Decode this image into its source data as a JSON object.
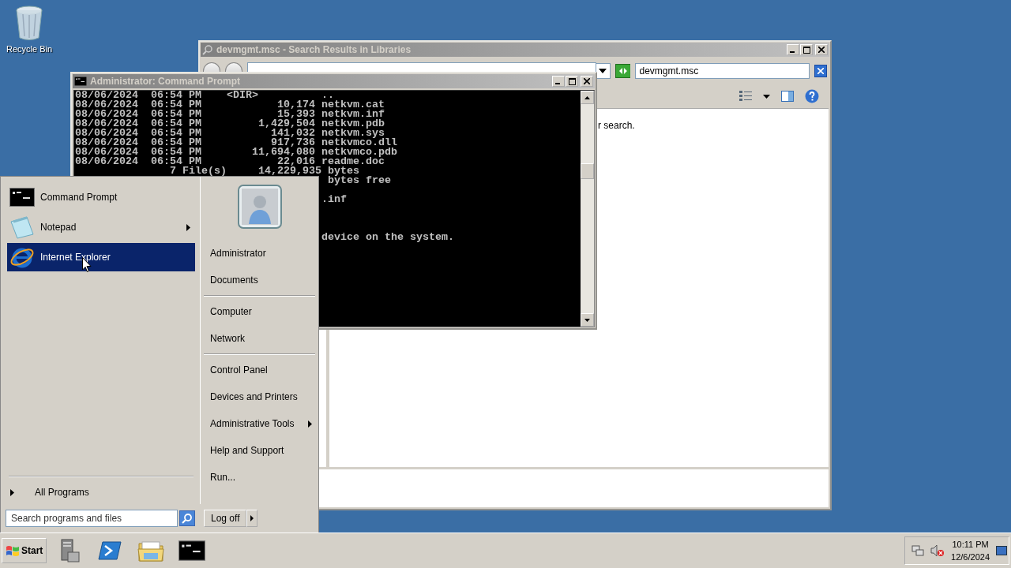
{
  "desktop_icons": [
    {
      "label": "Recycle Bin"
    }
  ],
  "explorer": {
    "title": "devmgmt.msc - Search Results in Libraries",
    "search": {
      "value": "devmgmt.msc"
    },
    "message": "r search."
  },
  "console": {
    "title": "Administrator: Command Prompt",
    "lines": [
      {
        "kind": "text",
        "text": "08/06/2024  06:54 PM    <DIR>          .."
      },
      {
        "kind": "text",
        "text": "08/06/2024  06:54 PM            10,174 netkvm.cat"
      },
      {
        "kind": "text",
        "text": "08/06/2024  06:54 PM            15,393 netkvm.inf"
      },
      {
        "kind": "text",
        "text": "08/06/2024  06:54 PM         1,429,504 netkvm.pdb"
      },
      {
        "kind": "text",
        "text": "08/06/2024  06:54 PM           141,032 netkvm.sys"
      },
      {
        "kind": "text",
        "text": "08/06/2024  06:54 PM           917,736 netkvmco.dll"
      },
      {
        "kind": "text",
        "text": "08/06/2024  06:54 PM        11,694,080 netkvmco.pdb"
      },
      {
        "kind": "text",
        "text": "08/06/2024  06:54 PM            22,016 readme.doc"
      },
      {
        "kind": "text",
        "text": "               7 File(s)     14,229,935 bytes"
      },
      {
        "kind": "text",
        "text": "                                        bytes free"
      },
      {
        "kind": "blank"
      },
      {
        "kind": "text",
        "text": "                                       .inf"
      },
      {
        "kind": "blank"
      },
      {
        "kind": "blank"
      },
      {
        "kind": "blank"
      },
      {
        "kind": "text",
        "text": "                                       device on the system."
      }
    ]
  },
  "start_menu": {
    "programs": [
      {
        "label": "Command Prompt",
        "kind": "console",
        "submenu": false,
        "selected": false
      },
      {
        "label": "Notepad",
        "kind": "notepad",
        "submenu": true,
        "selected": false
      },
      {
        "label": "Internet Explorer",
        "kind": "browser",
        "submenu": false,
        "selected": true
      }
    ],
    "all_programs": "All Programs",
    "search": {
      "placeholder": "Search programs and files"
    },
    "place_groups": [
      {
        "items": [
          {
            "label": "Administrator",
            "submenu": false
          },
          {
            "label": "Documents",
            "submenu": false
          }
        ]
      },
      {
        "items": [
          {
            "label": "Computer",
            "submenu": false
          },
          {
            "label": "Network",
            "submenu": false
          }
        ]
      },
      {
        "items": [
          {
            "label": "Control Panel",
            "submenu": false
          },
          {
            "label": "Devices and Printers",
            "submenu": false
          },
          {
            "label": "Administrative Tools",
            "submenu": true
          },
          {
            "label": "Help and Support",
            "submenu": false
          },
          {
            "label": "Run...",
            "submenu": false
          }
        ]
      }
    ],
    "log_off": "Log off"
  },
  "taskbar": {
    "start": "Start",
    "buttons": [
      {
        "kind": "server"
      },
      {
        "kind": "powershell"
      },
      {
        "kind": "folder"
      },
      {
        "kind": "console"
      }
    ],
    "clock": {
      "time": "10:11 PM",
      "date": "12/6/2024"
    }
  }
}
